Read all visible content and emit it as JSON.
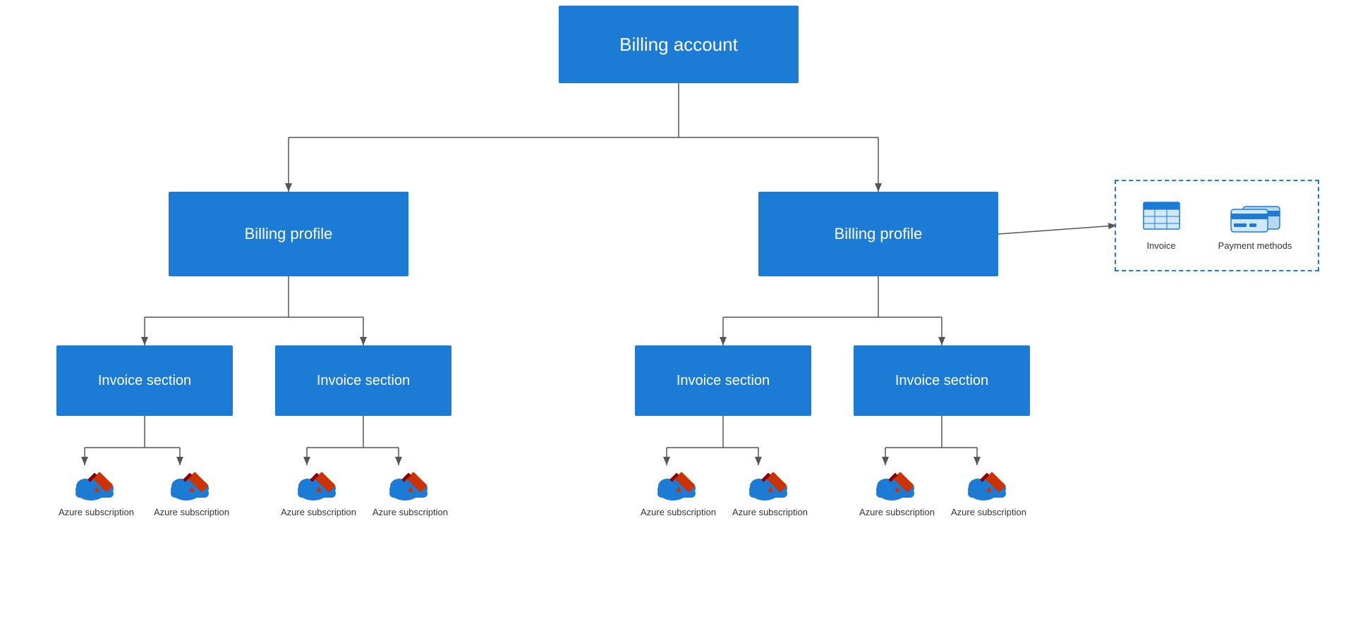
{
  "billing_account": {
    "label": "Billing account"
  },
  "billing_profile_left": {
    "label": "Billing profile"
  },
  "billing_profile_right": {
    "label": "Billing profile"
  },
  "invoice_sections": [
    {
      "label": "Invoice section"
    },
    {
      "label": "Invoice section"
    },
    {
      "label": "Invoice section"
    },
    {
      "label": "Invoice section"
    }
  ],
  "azure_subscriptions": [
    {
      "label": "Azure subscription"
    },
    {
      "label": "Azure subscription"
    },
    {
      "label": "Azure subscription"
    },
    {
      "label": "Azure subscription"
    },
    {
      "label": "Azure subscription"
    },
    {
      "label": "Azure subscription"
    },
    {
      "label": "Azure subscription"
    },
    {
      "label": "Azure subscription"
    }
  ],
  "callout": {
    "invoice_label": "Invoice",
    "payment_label": "Payment methods"
  },
  "colors": {
    "blue": "#1c7cd5",
    "line": "#555555",
    "dashed": "#1c7cd5"
  }
}
